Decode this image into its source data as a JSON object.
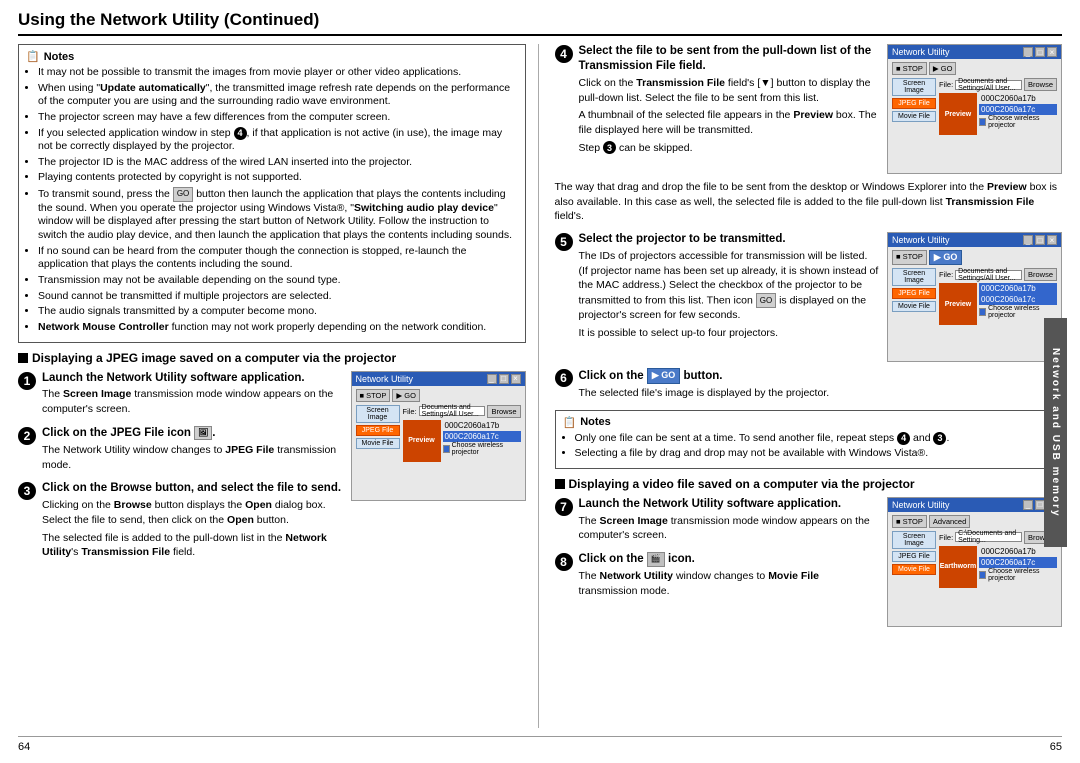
{
  "page": {
    "title": "Using the Network Utility (Continued)",
    "left_page_num": "64",
    "right_page_num": "65"
  },
  "sidebar_label": "Network and USB memory",
  "notes_left": {
    "title": "Notes",
    "items": [
      "It may not be possible to transmit the images from movie player or other video applications.",
      "When using \"Update automatically\", the transmitted image refresh rate depends on the performance of the computer you are using and the surrounding radio wave environment.",
      "The projector screen may have a few differences from the computer screen.",
      "If you selected application window in step 4, if that application is not active (in use), the image may not be correctly displayed by the projector.",
      "The projector ID is the MAC address of the wired LAN inserted into the projector.",
      "Playing contents protected by copyright is not supported.",
      "To transmit sound, press the [GO] button then launch the application that plays the contents including the sound. When you operate the projector using Windows Vista®, \"Switching audio play device\" window will be displayed after pressing the start button of Network Utility. Follow the instruction to switch the audio play device, and then launch the application that plays the contents including sounds.",
      "If no sound can be heard from the computer though the connection is stopped, re-launch the application that plays the contents including the sound.",
      "Transmission may not be available depending on the sound type.",
      "Sound cannot be transmitted if multiple projectors are selected.",
      "The audio signals transmitted by a computer become mono.",
      "Network Mouse Controller function may not work properly depending on the network condition."
    ]
  },
  "section_jpeg": {
    "header": "Displaying a JPEG image saved on a computer via the projector",
    "steps": [
      {
        "num": "1",
        "title": "Launch the Network Utility software application.",
        "body": "The Screen Image transmission mode window appears on the computer's screen."
      },
      {
        "num": "2",
        "title": "Click on the JPEG File icon",
        "body": "The Network Utility window changes to JPEG File transmission mode."
      },
      {
        "num": "3",
        "title": "Click on the Browse button, and select the file to send.",
        "body": "Clicking on the Browse button displays the Open dialog box. Select the file to send, then click on the Open button.",
        "body2": "The selected file is added to the pull-down list in the Network Utility's Transmission File field."
      }
    ]
  },
  "section_right_top": {
    "step4": {
      "num": "4",
      "title": "Select the file to be sent from the pull-down list of the Transmission File field.",
      "body1": "Click on the Transmission File field's [▼] button to display the pull-down list. Select the file to be sent from this list.",
      "body2": "A thumbnail of the selected file appears in the Preview box. The file displayed here will be transmitted.",
      "body3": "Step 3 can be skipped.",
      "body4": "The way that drag and drop the file to be sent from the desktop or Windows Explorer into the Preview box is also available. In this case as well, the selected file is added to the file pull-down list Transmission File field's."
    },
    "step5": {
      "num": "5",
      "title": "Select the projector to be transmitted.",
      "body": "The IDs of projectors accessible for transmission will be listed. (If projector name has been set up already, it is shown instead of the MAC address.) Select the checkbox of the projector to be transmitted to from this list. Then icon [GO] is displayed on the projector's screen for few seconds.",
      "body2": "It is possible to select up-to four projectors."
    },
    "step6": {
      "num": "6",
      "title": "Click on the [GO] button.",
      "body": "The selected file's image is displayed by the projector."
    }
  },
  "notes_right": {
    "title": "Notes",
    "items": [
      "Only one file can be sent at a time. To send another file, repeat steps 4 and 3.",
      "Selecting a file by drag and drop may not be available with Windows Vista®."
    ]
  },
  "section_video": {
    "header": "Displaying a video file saved on a computer via the projector",
    "step7": {
      "num": "7",
      "title": "Launch the Network Utility software application.",
      "body": "The Screen Image transmission mode window appears on the computer's screen."
    },
    "step8": {
      "num": "8",
      "title": "Click on the [Movie File] icon.",
      "body": "The Network Utility window changes to Movie File transmission mode."
    }
  },
  "screenshot1": {
    "title": "Network Utility",
    "toolbar": [
      "■ STOP",
      "▶ GO"
    ],
    "file_items": [
      "000C2060a17b",
      "000C2060a17c"
    ],
    "sidebar_items": [
      "Screen Image",
      "JPEG File",
      "Movie File"
    ]
  },
  "screenshot2": {
    "title": "Network Utility"
  },
  "screenshot3": {
    "title": "Network Utility"
  }
}
